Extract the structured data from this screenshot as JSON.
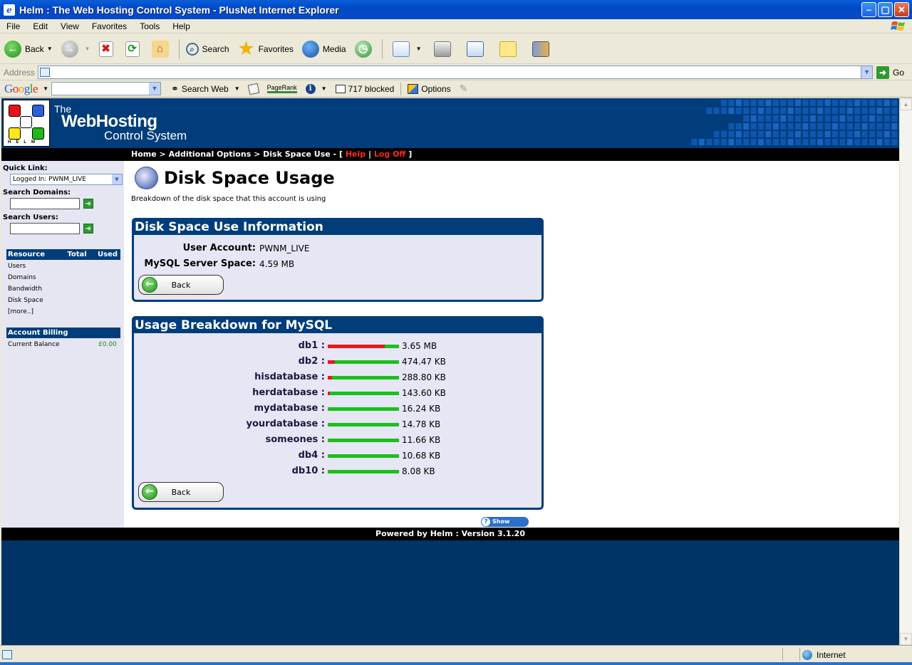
{
  "window": {
    "title": "Helm : The Web Hosting Control System - PlusNet Internet Explorer"
  },
  "menu": {
    "items": [
      "File",
      "Edit",
      "View",
      "Favorites",
      "Tools",
      "Help"
    ]
  },
  "toolbar": {
    "back_label": "Back",
    "search_label": "Search",
    "favorites_label": "Favorites",
    "media_label": "Media"
  },
  "address": {
    "label": "Address",
    "value": "",
    "go_label": "Go"
  },
  "google_toolbar": {
    "logo": "Google",
    "search_web_label": "Search Web",
    "pagerank_label": "PageRank",
    "blocked_label": "717 blocked",
    "options_label": "Options"
  },
  "helm": {
    "logo_letters": "HELM",
    "brand_the": "The",
    "brand_webhosting": "WebHosting",
    "brand_control": "Control System",
    "breadcrumb": {
      "home": "Home",
      "sep1": " > ",
      "additional": "Additional Options",
      "sep2": " > ",
      "current": "Disk Space Use",
      "open": " - [ ",
      "help": "Help",
      "pipe": " | ",
      "logoff": "Log Off",
      "close": " ]"
    }
  },
  "sidebar": {
    "quick_link_label": "Quick Link:",
    "quick_link_value": "Logged In: PWNM_LIVE",
    "search_domains_label": "Search Domains:",
    "search_users_label": "Search Users:",
    "resource_header": [
      "Resource",
      "Total",
      "Used"
    ],
    "resources": [
      "Users",
      "Domains",
      "Bandwidth",
      "Disk Space",
      "[more..]"
    ],
    "billing_header": "Account Billing",
    "billing_label": "Current Balance",
    "billing_value": "£0.00"
  },
  "main": {
    "title": "Disk Space Usage",
    "description": "Breakdown of the disk space that this account is using",
    "info_panel": {
      "title": "Disk Space Use Information",
      "user_account_label": "User Account:",
      "user_account_value": "PWNM_LIVE",
      "mysql_label": "MySQL Server Space:",
      "mysql_value": "4.59 MB",
      "back_label": "Back"
    },
    "breakdown_panel": {
      "title": "Usage Breakdown for MySQL",
      "back_label": "Back",
      "databases": [
        {
          "name": "db1 :",
          "size": "3.65 MB",
          "fraction": 0.795
        },
        {
          "name": "db2 :",
          "size": "474.47 KB",
          "fraction": 0.1
        },
        {
          "name": "hisdatabase :",
          "size": "288.80 KB",
          "fraction": 0.06
        },
        {
          "name": "herdatabase :",
          "size": "143.60 KB",
          "fraction": 0.03
        },
        {
          "name": "mydatabase :",
          "size": "16.24 KB",
          "fraction": 0.0
        },
        {
          "name": "yourdatabase :",
          "size": "14.78 KB",
          "fraction": 0.0
        },
        {
          "name": "someones :",
          "size": "11.66 KB",
          "fraction": 0.0
        },
        {
          "name": "db4 :",
          "size": "10.68 KB",
          "fraction": 0.0
        },
        {
          "name": "db10 :",
          "size": "8.08 KB",
          "fraction": 0.0
        }
      ]
    },
    "quickhelp_label": "Show QuickHelp"
  },
  "footer": {
    "text": "Powered by Helm  :  Version 3.1.20"
  },
  "status": {
    "zone": "Internet"
  },
  "colors": {
    "helm_blue": "#003d7a",
    "bar_used": "#e01c1c",
    "bar_free": "#1cbf1c",
    "link_red": "#ff2a1a"
  }
}
